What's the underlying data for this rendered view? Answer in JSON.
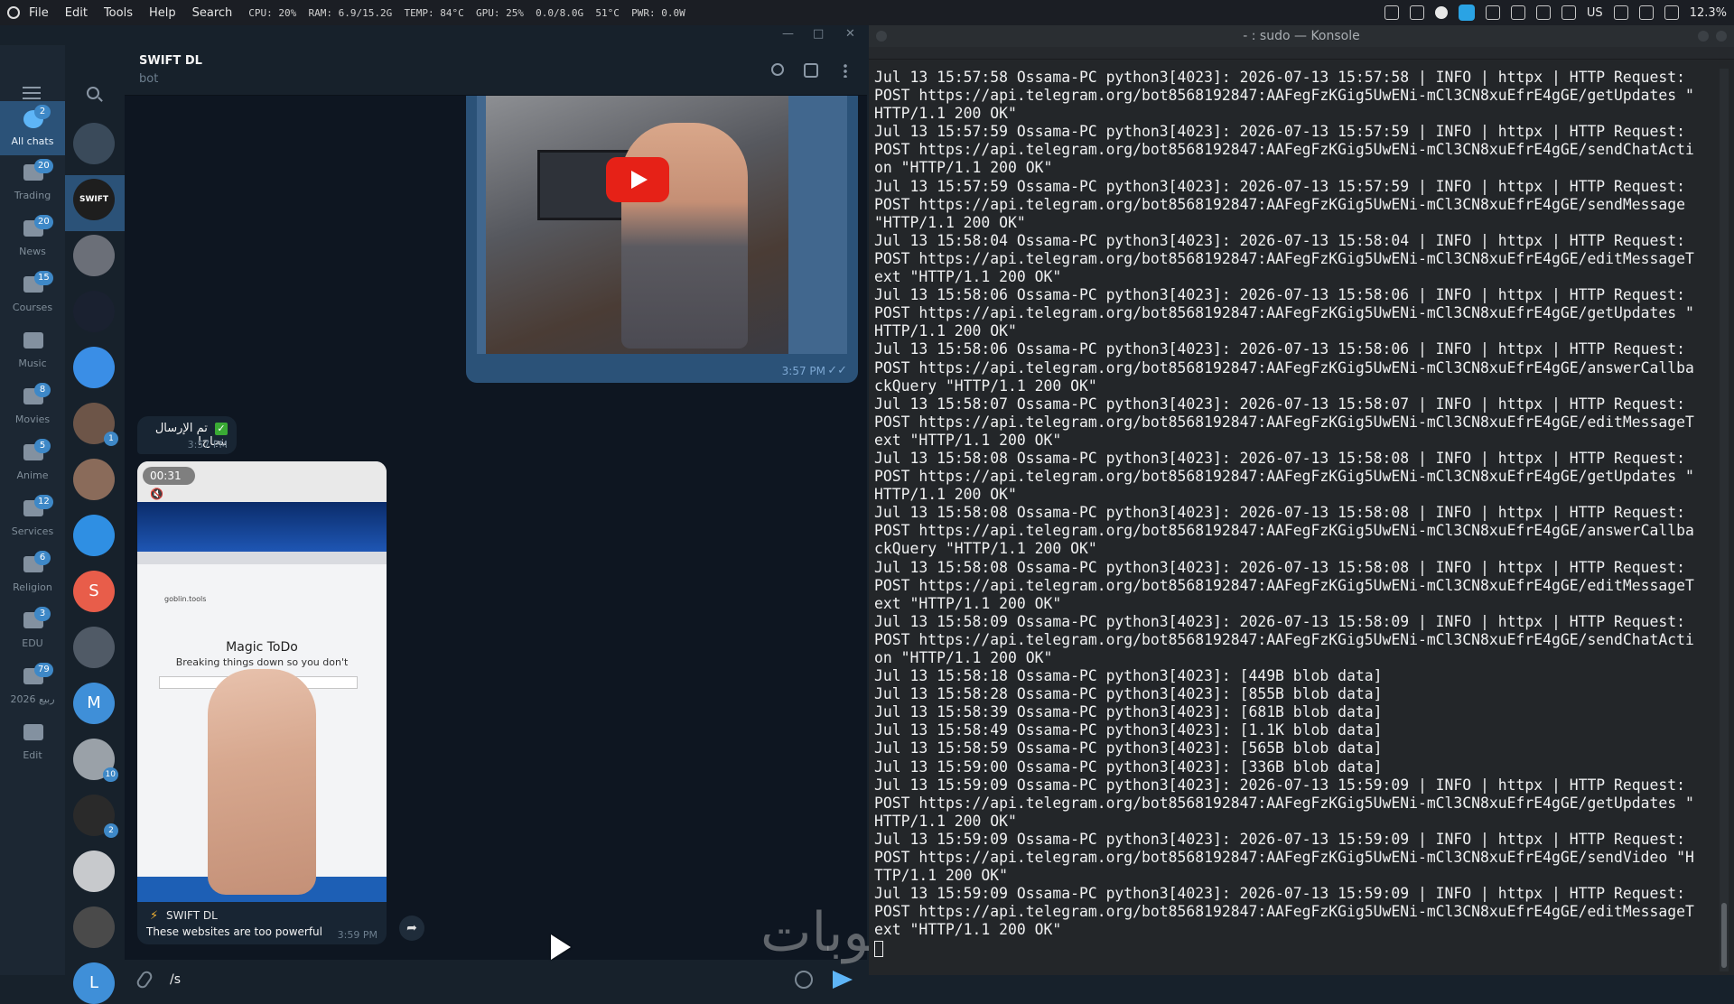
{
  "topbar": {
    "menu": [
      "File",
      "Edit",
      "Tools",
      "Help",
      "Search"
    ],
    "stats": "CPU: 20%  RAM: 6.9/15.2G  TEMP: 84°C  GPU: 25%  0.0/8.0G  51°C  PWR: 0.0W",
    "keyboard_layout": "US",
    "battery": "12.3%"
  },
  "folders": [
    {
      "label": "All chats",
      "badge": "2",
      "active": true
    },
    {
      "label": "Trading",
      "badge": "20"
    },
    {
      "label": "News",
      "badge": "20"
    },
    {
      "label": "Courses",
      "badge": "15"
    },
    {
      "label": "Music",
      "badge": ""
    },
    {
      "label": "Movies",
      "badge": "8"
    },
    {
      "label": "Anime",
      "badge": "5"
    },
    {
      "label": "Services",
      "badge": "12"
    },
    {
      "label": "Religion",
      "badge": "6"
    },
    {
      "label": "EDU",
      "badge": "3"
    },
    {
      "label": "ربيع 2026",
      "badge": "79"
    },
    {
      "label": "Edit",
      "badge": ""
    }
  ],
  "avatars": [
    {
      "letter": "",
      "color": "#3a4a5a",
      "badge": ""
    },
    {
      "letter": "SWIFT",
      "color": "#1e1e1e",
      "badge": ""
    },
    {
      "letter": "",
      "color": "#6b6f78",
      "badge": ""
    },
    {
      "letter": "",
      "color": "#1a2130",
      "badge": ""
    },
    {
      "letter": "",
      "color": "#3a8ee6",
      "badge": ""
    },
    {
      "letter": "",
      "color": "#6d5548",
      "badge": "1"
    },
    {
      "letter": "",
      "color": "#8a6b5a",
      "badge": ""
    },
    {
      "letter": "",
      "color": "#2f8fe3",
      "badge": ""
    },
    {
      "letter": "S",
      "color": "#e85d4a",
      "badge": ""
    },
    {
      "letter": "",
      "color": "#505a66",
      "badge": ""
    },
    {
      "letter": "M",
      "color": "#3f8fd8",
      "badge": ""
    },
    {
      "letter": "",
      "color": "#9aa1a8",
      "badge": "10"
    },
    {
      "letter": "",
      "color": "#2a2a2a",
      "badge": "2"
    },
    {
      "letter": "",
      "color": "#c7c9cc",
      "badge": ""
    },
    {
      "letter": "",
      "color": "#4a4a4a",
      "badge": ""
    },
    {
      "letter": "L",
      "color": "#3f8fd8",
      "badge": ""
    }
  ],
  "chat": {
    "name": "SWIFT DL",
    "subtitle": "bot",
    "out_video_time": "3:57 PM",
    "out_video_ticks": "✓✓",
    "in_text": "تم الإرسال بنجاح!",
    "in_text_check": "✓",
    "in_text_time": "3:57 PM",
    "in_video_duration": "00:31",
    "in_video_mute": "🔇",
    "in_video_screen_title": "Magic ToDo",
    "in_video_screen_sub": "Breaking things down so you don't",
    "in_video_screen_brand": "goblin.tools",
    "in_video_bot_icon": "⚡",
    "in_video_bot": "SWIFT DL",
    "in_video_caption": "These websites are too powerful",
    "in_video_time": "3:59 PM",
    "share_icon": "➦",
    "composer_value": "/s"
  },
  "watermark": "حسوبات",
  "konsole": {
    "title": "- : sudo — Konsole",
    "lines": [
      "Jul 13 15:57:58 Ossama-PC python3[4023]: 2026-07-13 15:57:58 | INFO | httpx | HTTP Request:",
      "POST https://api.telegram.org/bot8568192847:AAFegFzKGig5UwENi-mCl3CN8xuEfrE4gGE/getUpdates \"",
      "HTTP/1.1 200 OK\"",
      "Jul 13 15:57:59 Ossama-PC python3[4023]: 2026-07-13 15:57:59 | INFO | httpx | HTTP Request:",
      "POST https://api.telegram.org/bot8568192847:AAFegFzKGig5UwENi-mCl3CN8xuEfrE4gGE/sendChatActi",
      "on \"HTTP/1.1 200 OK\"",
      "Jul 13 15:57:59 Ossama-PC python3[4023]: 2026-07-13 15:57:59 | INFO | httpx | HTTP Request:",
      "POST https://api.telegram.org/bot8568192847:AAFegFzKGig5UwENi-mCl3CN8xuEfrE4gGE/sendMessage",
      "\"HTTP/1.1 200 OK\"",
      "Jul 13 15:58:04 Ossama-PC python3[4023]: 2026-07-13 15:58:04 | INFO | httpx | HTTP Request:",
      "POST https://api.telegram.org/bot8568192847:AAFegFzKGig5UwENi-mCl3CN8xuEfrE4gGE/editMessageT",
      "ext \"HTTP/1.1 200 OK\"",
      "Jul 13 15:58:06 Ossama-PC python3[4023]: 2026-07-13 15:58:06 | INFO | httpx | HTTP Request:",
      "POST https://api.telegram.org/bot8568192847:AAFegFzKGig5UwENi-mCl3CN8xuEfrE4gGE/getUpdates \"",
      "HTTP/1.1 200 OK\"",
      "Jul 13 15:58:06 Ossama-PC python3[4023]: 2026-07-13 15:58:06 | INFO | httpx | HTTP Request:",
      "POST https://api.telegram.org/bot8568192847:AAFegFzKGig5UwENi-mCl3CN8xuEfrE4gGE/answerCallba",
      "ckQuery \"HTTP/1.1 200 OK\"",
      "Jul 13 15:58:07 Ossama-PC python3[4023]: 2026-07-13 15:58:07 | INFO | httpx | HTTP Request:",
      "POST https://api.telegram.org/bot8568192847:AAFegFzKGig5UwENi-mCl3CN8xuEfrE4gGE/editMessageT",
      "ext \"HTTP/1.1 200 OK\"",
      "Jul 13 15:58:08 Ossama-PC python3[4023]: 2026-07-13 15:58:08 | INFO | httpx | HTTP Request:",
      "POST https://api.telegram.org/bot8568192847:AAFegFzKGig5UwENi-mCl3CN8xuEfrE4gGE/getUpdates \"",
      "HTTP/1.1 200 OK\"",
      "Jul 13 15:58:08 Ossama-PC python3[4023]: 2026-07-13 15:58:08 | INFO | httpx | HTTP Request:",
      "POST https://api.telegram.org/bot8568192847:AAFegFzKGig5UwENi-mCl3CN8xuEfrE4gGE/answerCallba",
      "ckQuery \"HTTP/1.1 200 OK\"",
      "Jul 13 15:58:08 Ossama-PC python3[4023]: 2026-07-13 15:58:08 | INFO | httpx | HTTP Request:",
      "POST https://api.telegram.org/bot8568192847:AAFegFzKGig5UwENi-mCl3CN8xuEfrE4gGE/editMessageT",
      "ext \"HTTP/1.1 200 OK\"",
      "Jul 13 15:58:09 Ossama-PC python3[4023]: 2026-07-13 15:58:09 | INFO | httpx | HTTP Request:",
      "POST https://api.telegram.org/bot8568192847:AAFegFzKGig5UwENi-mCl3CN8xuEfrE4gGE/sendChatActi",
      "on \"HTTP/1.1 200 OK\"",
      "Jul 13 15:58:18 Ossama-PC python3[4023]: [449B blob data]",
      "Jul 13 15:58:28 Ossama-PC python3[4023]: [855B blob data]",
      "Jul 13 15:58:39 Ossama-PC python3[4023]: [681B blob data]",
      "Jul 13 15:58:49 Ossama-PC python3[4023]: [1.1K blob data]",
      "Jul 13 15:58:59 Ossama-PC python3[4023]: [565B blob data]",
      "Jul 13 15:59:00 Ossama-PC python3[4023]: [336B blob data]",
      "Jul 13 15:59:09 Ossama-PC python3[4023]: 2026-07-13 15:59:09 | INFO | httpx | HTTP Request:",
      "POST https://api.telegram.org/bot8568192847:AAFegFzKGig5UwENi-mCl3CN8xuEfrE4gGE/getUpdates \"",
      "HTTP/1.1 200 OK\"",
      "Jul 13 15:59:09 Ossama-PC python3[4023]: 2026-07-13 15:59:09 | INFO | httpx | HTTP Request:",
      "POST https://api.telegram.org/bot8568192847:AAFegFzKGig5UwENi-mCl3CN8xuEfrE4gGE/sendVideo \"H",
      "TTP/1.1 200 OK\"",
      "Jul 13 15:59:09 Ossama-PC python3[4023]: 2026-07-13 15:59:09 | INFO | httpx | HTTP Request:",
      "POST https://api.telegram.org/bot8568192847:AAFegFzKGig5UwENi-mCl3CN8xuEfrE4gGE/editMessageT",
      "ext \"HTTP/1.1 200 OK\""
    ]
  }
}
